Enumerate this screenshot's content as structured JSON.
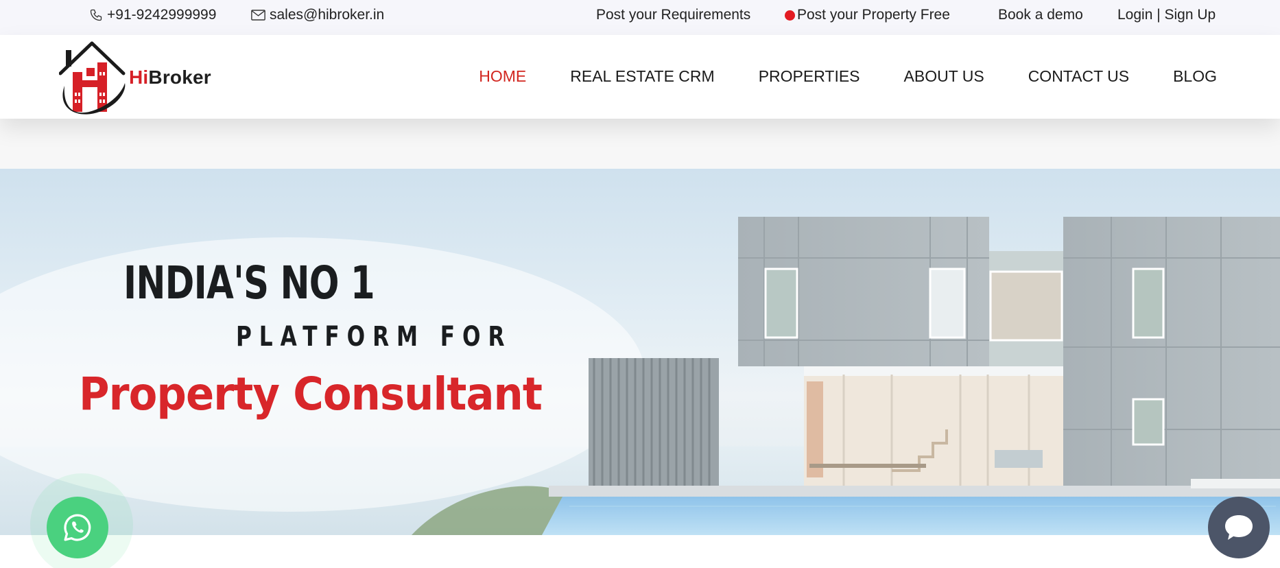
{
  "topbar": {
    "phone": "+91-9242999999",
    "email": "sales@hibroker.in",
    "post_requirements": "Post your Requirements",
    "post_property": "Post your Property Free",
    "book_demo": "Book a demo",
    "login_signup": "Login | Sign Up"
  },
  "brand": {
    "name_part1": "Hi",
    "name_part2": "Broker",
    "accent_color": "#d62027"
  },
  "nav": {
    "items": [
      "HOME",
      "REAL ESTATE CRM",
      "PROPERTIES",
      "ABOUT US",
      "CONTACT US",
      "BLOG"
    ],
    "active": "HOME"
  },
  "hero": {
    "line1": "INDIA'S NO 1",
    "line2": "PLATFORM FOR",
    "line3": "Property Consultant"
  },
  "floating": {
    "whatsapp_icon": "whatsapp-icon",
    "chat_icon": "chat-bubble-icon",
    "whatsapp_color": "#4ad17f",
    "chat_color": "#4c5568"
  }
}
